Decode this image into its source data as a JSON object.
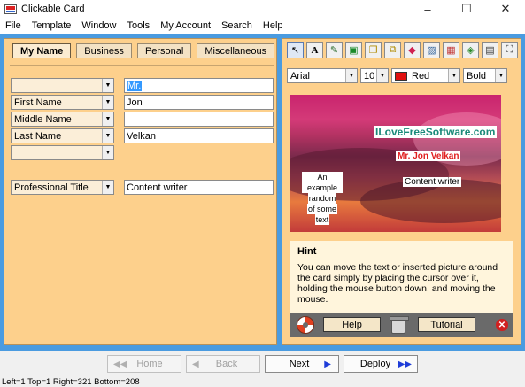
{
  "window": {
    "title": "Clickable Card",
    "controls": [
      "–",
      "☐",
      "✕"
    ]
  },
  "menu": [
    "File",
    "Template",
    "Window",
    "Tools",
    "My Account",
    "Search",
    "Help"
  ],
  "tabs": [
    {
      "label": "My Name",
      "active": true
    },
    {
      "label": "Business",
      "active": false
    },
    {
      "label": "Personal",
      "active": false
    },
    {
      "label": "Miscellaneous",
      "active": false
    }
  ],
  "fields": [
    {
      "label": "",
      "value": "Mr."
    },
    {
      "label": "First Name",
      "value": "Jon"
    },
    {
      "label": "Middle Name",
      "value": ""
    },
    {
      "label": "Last Name",
      "value": "Velkan"
    },
    {
      "label": "",
      "value": null
    },
    {
      "label": "Professional Title",
      "value": "Content writer"
    }
  ],
  "toolbar": {
    "icons": [
      "pointer-icon",
      "text-icon",
      "edit-icon",
      "layers-icon",
      "copy-icon",
      "paste-icon",
      "eraser-icon",
      "picture-icon",
      "color-grid-icon",
      "fill-icon",
      "frame-icon",
      "expand-icon"
    ]
  },
  "format": {
    "font": "Arial",
    "size": "10",
    "color": "Red",
    "color_hex": "#e01010",
    "weight": "Bold"
  },
  "card": {
    "website": "ILoveFreeSoftware.com",
    "name": "Mr. Jon Velkan",
    "title": "Content writer",
    "example_lines": [
      "An example",
      "random",
      "of some",
      "text"
    ]
  },
  "hint": {
    "title": "Hint",
    "body": "You can move the text or inserted picture around the card simply by placing the cursor over it, holding the mouse button down, and moving the mouse."
  },
  "panel_buttons": {
    "help": "Help",
    "tutorial": "Tutorial"
  },
  "nav": {
    "home": "Home",
    "back": "Back",
    "next": "Next",
    "deploy": "Deploy"
  },
  "status": "Left=1 Top=1 Right=321 Bottom=208"
}
